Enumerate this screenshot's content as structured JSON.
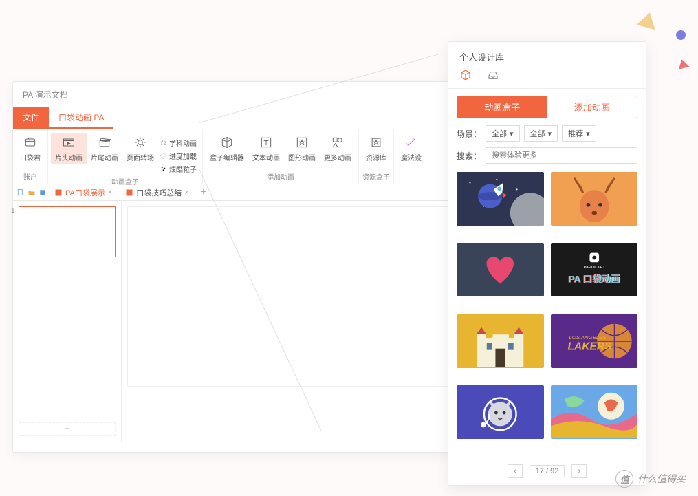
{
  "window": {
    "title": "PA 演示文档"
  },
  "tabs": {
    "file": "文件",
    "active": "口袋动画 PA"
  },
  "ribbon": {
    "groups": [
      {
        "label": "账户",
        "items": [
          {
            "name": "口袋君"
          }
        ]
      },
      {
        "label": "动画盒子",
        "items": [
          {
            "name": "片头动画",
            "active": true
          },
          {
            "name": "片尾动画"
          },
          {
            "name": "页面转场"
          }
        ],
        "textcol": [
          "学科动画",
          "进度加载",
          "炫酷粒子"
        ]
      },
      {
        "label": "添加动画",
        "items": [
          {
            "name": "盒子编辑器"
          },
          {
            "name": "文本动画"
          },
          {
            "name": "图形动画"
          },
          {
            "name": "更多动画"
          }
        ]
      },
      {
        "label": "资源盒子",
        "items": [
          {
            "name": "资源库"
          }
        ]
      },
      {
        "label": "",
        "items": [
          {
            "name": "魔法设"
          }
        ]
      }
    ]
  },
  "docTabs": [
    {
      "label": "PA口袋展示",
      "active": true
    },
    {
      "label": "口袋技巧总结",
      "active": false
    }
  ],
  "slide": {
    "num": "1"
  },
  "panel": {
    "title": "个人设计库",
    "tabs": [
      "动画盒子",
      "添加动画"
    ],
    "filterLabel": "场景：",
    "filters": [
      "全部",
      "全部",
      "推荐"
    ],
    "searchLabel": "搜索：",
    "searchPlaceholder": "搜索体验更多",
    "pager": {
      "current": "17",
      "total": "92",
      "sep": "/"
    }
  },
  "watermark": "什么值得买"
}
